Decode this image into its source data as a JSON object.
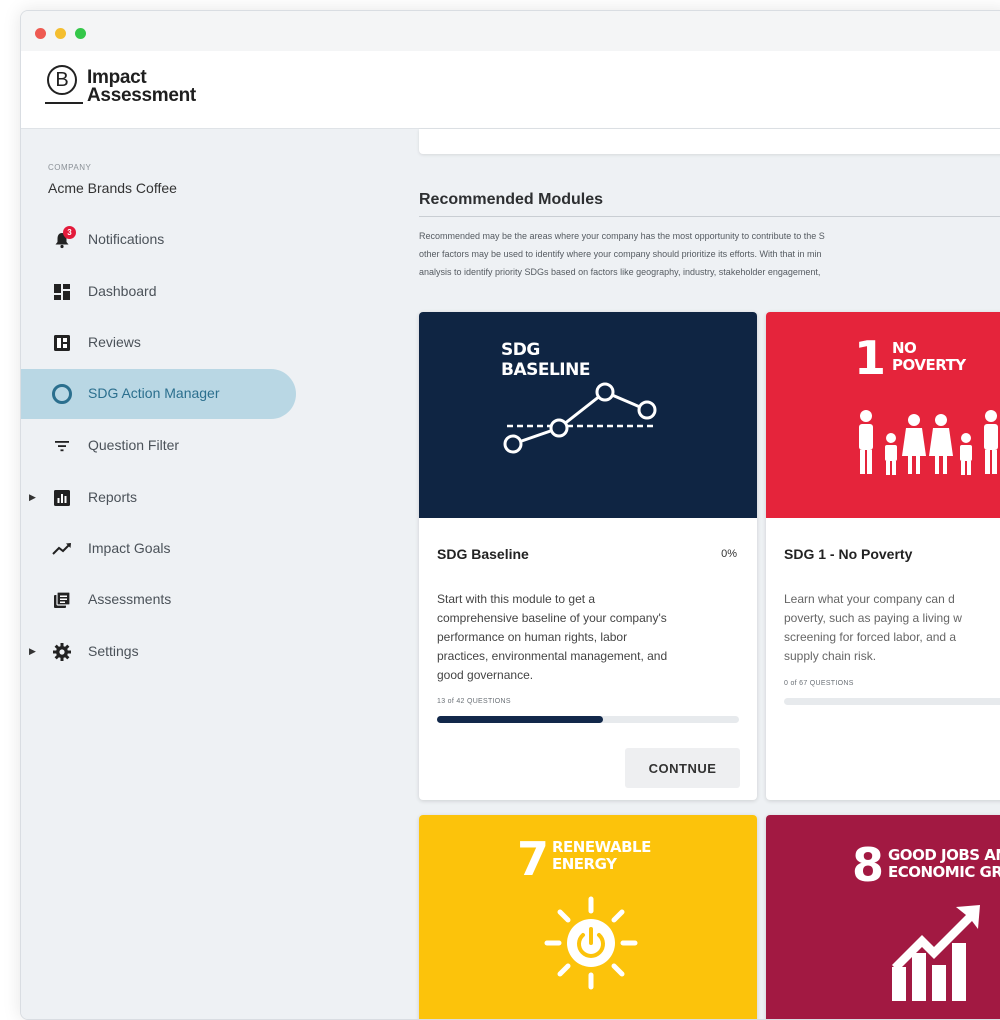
{
  "window": {
    "controls": [
      "close",
      "minimize",
      "maximize"
    ]
  },
  "brand": {
    "logo_letter": "B",
    "line1": "Impact",
    "line2": "Assessment"
  },
  "company": {
    "caption": "COMPANY",
    "name": "Acme Brands Coffee"
  },
  "sidebar": {
    "items": [
      {
        "label": "Notifications",
        "icon": "bell-icon",
        "badge": "3"
      },
      {
        "label": "Dashboard",
        "icon": "dashboard-icon"
      },
      {
        "label": "Reviews",
        "icon": "reviews-icon"
      },
      {
        "label": "SDG Action Manager",
        "icon": "ring-icon",
        "active": true
      },
      {
        "label": "Question Filter",
        "icon": "filter-icon"
      },
      {
        "label": "Reports",
        "icon": "reports-icon",
        "expandable": true
      },
      {
        "label": "Impact Goals",
        "icon": "trend-icon"
      },
      {
        "label": "Assessments",
        "icon": "assessments-icon"
      },
      {
        "label": "Settings",
        "icon": "gear-icon",
        "expandable": true
      }
    ]
  },
  "main": {
    "section_title": "Recommended Modules",
    "description": [
      "Recommended may be the areas where your company has the most opportunity to contribute to the S",
      "other factors may be used to identify where your company should prioritize its efforts. With that in min",
      "analysis to identify priority SDGs based on factors like geography, industry, stakeholder engagement,"
    ],
    "cards": [
      {
        "hero_color": "#0f2543",
        "hero_line1": "SDG",
        "hero_line2": "BASELINE",
        "title": "SDG Baseline",
        "percent": "0%",
        "description": [
          "Start with this module to get a",
          "comprehensive baseline of your company's",
          "performance on human rights, labor",
          "practices, environmental management, and",
          "good governance."
        ],
        "questions": "13 of 42 QUESTIONS",
        "progress": 0.55,
        "button": "CONTNUE"
      },
      {
        "hero_color": "#e5243b",
        "hero_number": "1",
        "hero_line1": "NO",
        "hero_line2": "POVERTY",
        "title": "SDG 1 - No Poverty",
        "description": [
          "Learn what your company can d",
          "poverty, such as paying a living w",
          "screening for forced labor, and a",
          "supply chain risk."
        ],
        "questions": "0 of 67 QUESTIONS",
        "progress": 0
      },
      {
        "hero_color": "#fcc30b",
        "hero_number": "7",
        "hero_line1": "RENEWABLE",
        "hero_line2": "ENERGY"
      },
      {
        "hero_color": "#a21942",
        "hero_number": "8",
        "hero_line1": "GOOD JOBS AND",
        "hero_line2": "ECONOMIC GROW"
      }
    ]
  }
}
